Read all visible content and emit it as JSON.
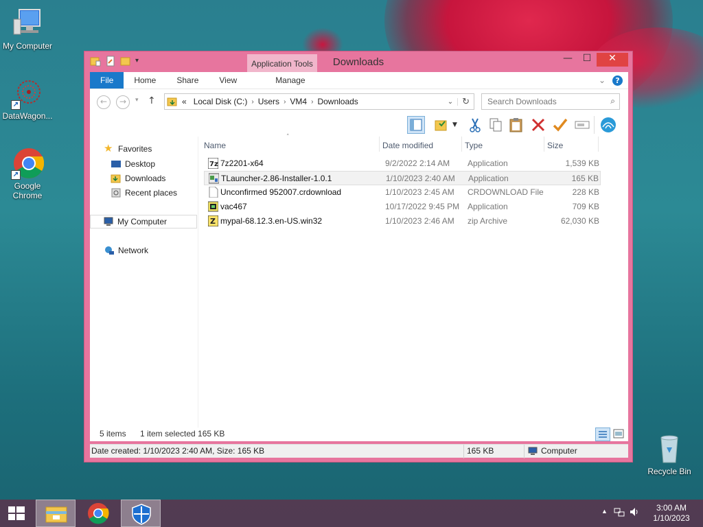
{
  "desktop": {
    "icons": [
      {
        "label": "My Computer"
      },
      {
        "label": "DataWagon..."
      },
      {
        "label": "Google Chrome"
      },
      {
        "label": "Recycle Bin"
      }
    ]
  },
  "window": {
    "title": "Downloads",
    "contextual_tab_group": "Application Tools",
    "tabs": [
      "File",
      "Home",
      "Share",
      "View",
      "Manage"
    ],
    "controls": {
      "minimize": "—",
      "maximize": "☐",
      "close": "✕"
    }
  },
  "address": {
    "overflow": "«",
    "crumbs": [
      "Local Disk (C:)",
      "Users",
      "VM4",
      "Downloads"
    ],
    "search_placeholder": "Search Downloads"
  },
  "navpane": {
    "favorites": "Favorites",
    "favorite_items": [
      "Desktop",
      "Downloads",
      "Recent places"
    ],
    "computer": "My Computer",
    "network": "Network"
  },
  "columns": {
    "name": "Name",
    "date": "Date modified",
    "type": "Type",
    "size": "Size"
  },
  "files": [
    {
      "name": "7z2201-x64",
      "date": "9/2/2022 2:14 AM",
      "type": "Application",
      "size": "1,539 KB",
      "icon": "7zip-icon"
    },
    {
      "name": "TLauncher-2.86-Installer-1.0.1",
      "date": "1/10/2023 2:40 AM",
      "type": "Application",
      "size": "165 KB",
      "icon": "installer-icon",
      "selected": true
    },
    {
      "name": "Unconfirmed 952007.crdownload",
      "date": "1/10/2023 2:45 AM",
      "type": "CRDOWNLOAD File",
      "size": "228 KB",
      "icon": "blank-file-icon"
    },
    {
      "name": "vac467",
      "date": "10/17/2022 9:45 PM",
      "type": "Application",
      "size": "709 KB",
      "icon": "app-icon"
    },
    {
      "name": "mypal-68.12.3.en-US.win32",
      "date": "1/10/2023 2:46 AM",
      "type": "zip Archive",
      "size": "62,030 KB",
      "icon": "zip-icon"
    }
  ],
  "status": {
    "items_count": "5 items",
    "selection": "1 item selected  165 KB"
  },
  "details": {
    "info": "Date created: 1/10/2023 2:40 AM, Size: 165 KB",
    "size": "165 KB",
    "location": "Computer"
  },
  "taskbar": {
    "time": "3:00 AM",
    "date": "1/10/2023"
  },
  "colors": {
    "window_frame": "#e7759e",
    "file_tab": "#1979ca",
    "taskbar": "#5c344c"
  }
}
